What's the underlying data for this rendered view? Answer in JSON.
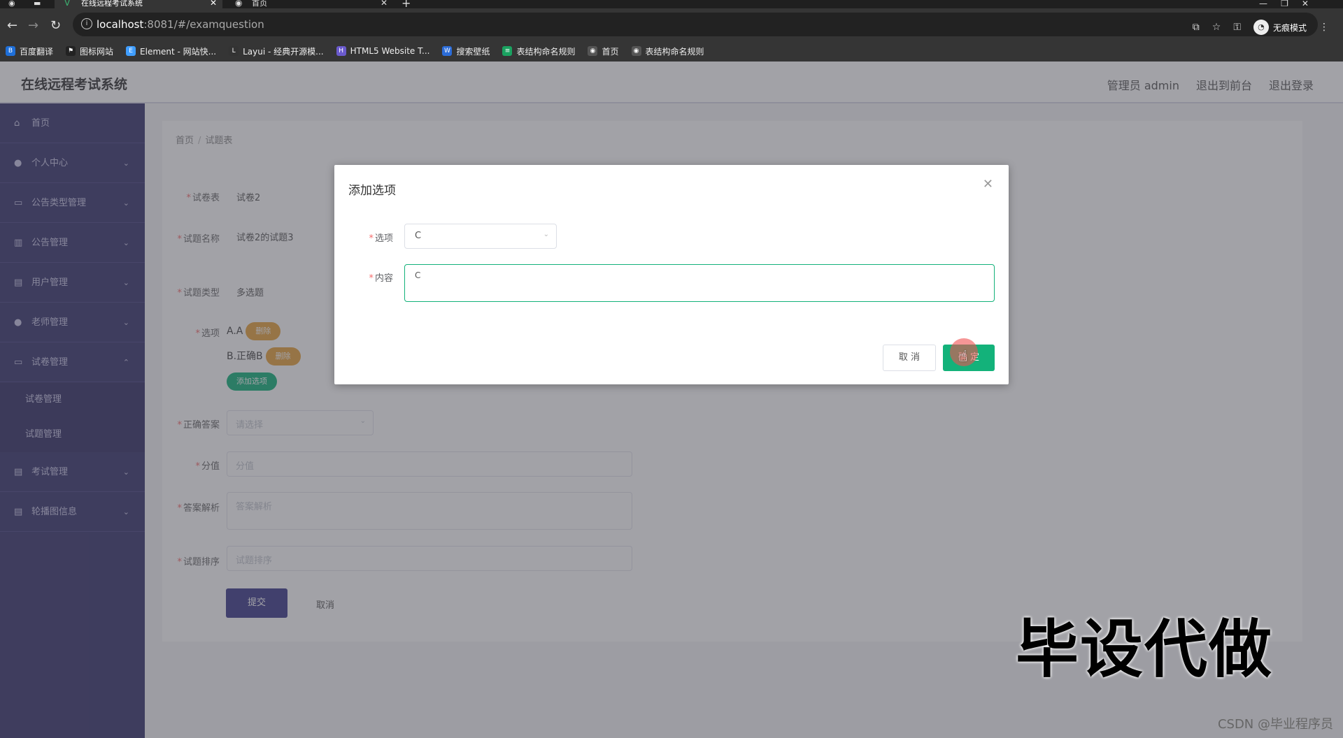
{
  "browser": {
    "tabs": [
      {
        "title": "在线远程考试系统",
        "active": true
      },
      {
        "title": "首页",
        "active": false
      }
    ],
    "url_host": "localhost",
    "url_rest": ":8081/#/examquestion",
    "incognito_label": "无痕模式",
    "bookmarks": [
      {
        "label": "百度翻译",
        "color": "#1e6fd9",
        "icon": "B"
      },
      {
        "label": "图标网站",
        "color": "#222",
        "icon": "⚑"
      },
      {
        "label": "Element - 网站快...",
        "color": "#409eff",
        "icon": "E"
      },
      {
        "label": "Layui - 经典开源模...",
        "color": "#333",
        "icon": "L"
      },
      {
        "label": "HTML5 Website T...",
        "color": "#6a5acd",
        "icon": "H"
      },
      {
        "label": "搜索壁纸",
        "color": "#2b6cd8",
        "icon": "W"
      },
      {
        "label": "表结构命名规则",
        "color": "#1aa260",
        "icon": "≡"
      },
      {
        "label": "首页",
        "color": "#555",
        "icon": "◉"
      },
      {
        "label": "表结构命名规则",
        "color": "#555",
        "icon": "◉"
      }
    ]
  },
  "app": {
    "title": "在线远程考试系统",
    "header_links": [
      "管理员 admin",
      "退出到前台",
      "退出登录"
    ]
  },
  "sidebar": {
    "items": [
      {
        "label": "首页",
        "icon": "⌂",
        "chevron": ""
      },
      {
        "label": "个人中心",
        "icon": "●",
        "chevron": "⌄"
      },
      {
        "label": "公告类型管理",
        "icon": "▭",
        "chevron": "⌄"
      },
      {
        "label": "公告管理",
        "icon": "▥",
        "chevron": "⌄"
      },
      {
        "label": "用户管理",
        "icon": "▤",
        "chevron": "⌄"
      },
      {
        "label": "老师管理",
        "icon": "●",
        "chevron": "⌄"
      },
      {
        "label": "试卷管理",
        "icon": "▭",
        "chevron": "⌃"
      }
    ],
    "sub_items": [
      "试卷管理",
      "试题管理"
    ],
    "after_items": [
      {
        "label": "考试管理",
        "icon": "▤",
        "chevron": "⌄"
      },
      {
        "label": "轮播图信息",
        "icon": "▤",
        "chevron": "⌄"
      }
    ]
  },
  "breadcrumb": [
    "首页",
    "试题表"
  ],
  "form": {
    "paper_label": "试卷表",
    "paper_value": "试卷2",
    "name_label": "试题名称",
    "name_value": "试卷2的试题3",
    "type_label": "试题类型",
    "type_value": "多选题",
    "options_label": "选项",
    "option_lines": [
      "A.A",
      "B.正确B"
    ],
    "delete_label": "删除",
    "add_option_label": "添加选项",
    "answer_label": "正确答案",
    "answer_placeholder": "请选择",
    "score_label": "分值",
    "score_placeholder": "分值",
    "analysis_label": "答案解析",
    "analysis_placeholder": "答案解析",
    "order_label": "试题排序",
    "order_placeholder": "试题排序",
    "submit_label": "提交",
    "cancel_label": "取消"
  },
  "dialog": {
    "title": "添加选项",
    "option_label": "选项",
    "option_value": "C",
    "content_label": "内容",
    "content_value": "C",
    "cancel_label": "取 消",
    "ok_label": "确 定"
  },
  "overlay_text": {
    "watermark": "毕设代做",
    "csdn": "CSDN @毕业程序员"
  }
}
